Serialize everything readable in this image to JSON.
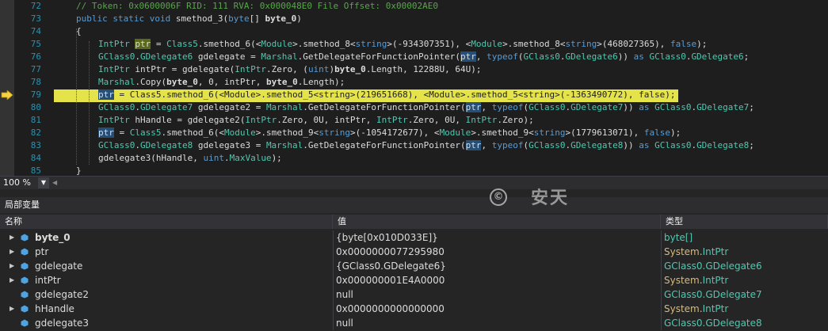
{
  "editor": {
    "line_numbers": [
      "72",
      "73",
      "74",
      "75",
      "76",
      "77",
      "78",
      "79",
      "80",
      "81",
      "82",
      "83",
      "84",
      "85"
    ],
    "current_line_marker": "arrow-right-icon",
    "lines": [
      {
        "tokens": [
          [
            "c",
            "// Token: 0x0600006F RID: 111 RVA: 0x000048E0 File Offset: 0x00002AE0"
          ]
        ]
      },
      {
        "tokens": [
          [
            "k",
            "public"
          ],
          [
            "",
            " "
          ],
          [
            "k",
            "static"
          ],
          [
            "",
            " "
          ],
          [
            "k",
            "void"
          ],
          [
            "",
            " smethod_3("
          ],
          [
            "k",
            "byte"
          ],
          [
            "",
            "[] "
          ],
          [
            "b",
            "byte_0"
          ],
          [
            "",
            ")"
          ]
        ]
      },
      {
        "tokens": [
          [
            "",
            "{"
          ]
        ]
      },
      {
        "tokens": [
          [
            "t",
            "IntPtr"
          ],
          [
            "",
            " "
          ],
          [
            "hl2",
            "ptr"
          ],
          [
            "",
            " = "
          ],
          [
            "t",
            "Class5"
          ],
          [
            "",
            ".smethod_6(<"
          ],
          [
            "t",
            "Module"
          ],
          [
            "",
            ">.smethod_8<"
          ],
          [
            "k",
            "string"
          ],
          [
            "",
            ">(-934307351), <"
          ],
          [
            "t",
            "Module"
          ],
          [
            "",
            ">.smethod_8<"
          ],
          [
            "k",
            "string"
          ],
          [
            "",
            ">(468027365), "
          ],
          [
            "k",
            "false"
          ],
          [
            "",
            ");"
          ]
        ]
      },
      {
        "tokens": [
          [
            "t",
            "GClass0"
          ],
          [
            "",
            "."
          ],
          [
            "t",
            "GDelegate6"
          ],
          [
            "",
            " gdelegate = "
          ],
          [
            "t",
            "Marshal"
          ],
          [
            "",
            ".GetDelegateForFunctionPointer("
          ],
          [
            "hl",
            "ptr"
          ],
          [
            "",
            ", "
          ],
          [
            "k",
            "typeof"
          ],
          [
            "",
            "("
          ],
          [
            "t",
            "GClass0"
          ],
          [
            "",
            "."
          ],
          [
            "t",
            "GDelegate6"
          ],
          [
            "",
            ")) "
          ],
          [
            "k",
            "as"
          ],
          [
            "",
            " "
          ],
          [
            "t",
            "GClass0"
          ],
          [
            "",
            "."
          ],
          [
            "t",
            "GDelegate6"
          ],
          [
            "",
            ";"
          ]
        ]
      },
      {
        "tokens": [
          [
            "t",
            "IntPtr"
          ],
          [
            "",
            " intPtr = gdelegate("
          ],
          [
            "t",
            "IntPtr"
          ],
          [
            "",
            ".Zero, ("
          ],
          [
            "k",
            "uint"
          ],
          [
            "",
            ")"
          ],
          [
            "b",
            "byte_0"
          ],
          [
            "",
            ".Length, 12288U, 64U);"
          ]
        ]
      },
      {
        "tokens": [
          [
            "t",
            "Marshal"
          ],
          [
            "",
            ".Copy("
          ],
          [
            "b",
            "byte_0"
          ],
          [
            "",
            ", 0, intPtr, "
          ],
          [
            "b",
            "byte_0"
          ],
          [
            "",
            ".Length);"
          ]
        ]
      },
      {
        "current": true,
        "tokens": [
          [
            "hl",
            "ptr"
          ],
          [
            "",
            " = Class5.smethod_6(<Module>.smethod_5<string>(219651668), <Module>.smethod_5<string>(-1363490772), false);"
          ]
        ]
      },
      {
        "tokens": [
          [
            "t",
            "GClass0"
          ],
          [
            "",
            "."
          ],
          [
            "t",
            "GDelegate7"
          ],
          [
            "",
            " gdelegate2 = "
          ],
          [
            "t",
            "Marshal"
          ],
          [
            "",
            ".GetDelegateForFunctionPointer("
          ],
          [
            "hl",
            "ptr"
          ],
          [
            "",
            ", "
          ],
          [
            "k",
            "typeof"
          ],
          [
            "",
            "("
          ],
          [
            "t",
            "GClass0"
          ],
          [
            "",
            "."
          ],
          [
            "t",
            "GDelegate7"
          ],
          [
            "",
            ")) "
          ],
          [
            "k",
            "as"
          ],
          [
            "",
            " "
          ],
          [
            "t",
            "GClass0"
          ],
          [
            "",
            "."
          ],
          [
            "t",
            "GDelegate7"
          ],
          [
            "",
            ";"
          ]
        ]
      },
      {
        "tokens": [
          [
            "t",
            "IntPtr"
          ],
          [
            "",
            " hHandle = gdelegate2("
          ],
          [
            "t",
            "IntPtr"
          ],
          [
            "",
            ".Zero, 0U, intPtr, "
          ],
          [
            "t",
            "IntPtr"
          ],
          [
            "",
            ".Zero, 0U, "
          ],
          [
            "t",
            "IntPtr"
          ],
          [
            "",
            ".Zero);"
          ]
        ]
      },
      {
        "tokens": [
          [
            "hl",
            "ptr"
          ],
          [
            "",
            " = "
          ],
          [
            "t",
            "Class5"
          ],
          [
            "",
            ".smethod_6(<"
          ],
          [
            "t",
            "Module"
          ],
          [
            "",
            ">.smethod_9<"
          ],
          [
            "k",
            "string"
          ],
          [
            "",
            ">(-1054172677), <"
          ],
          [
            "t",
            "Module"
          ],
          [
            "",
            ">.smethod_9<"
          ],
          [
            "k",
            "string"
          ],
          [
            "",
            ">(1779613071), "
          ],
          [
            "k",
            "false"
          ],
          [
            "",
            ");"
          ]
        ]
      },
      {
        "tokens": [
          [
            "t",
            "GClass0"
          ],
          [
            "",
            "."
          ],
          [
            "t",
            "GDelegate8"
          ],
          [
            "",
            " gdelegate3 = "
          ],
          [
            "t",
            "Marshal"
          ],
          [
            "",
            ".GetDelegateForFunctionPointer("
          ],
          [
            "hl",
            "ptr"
          ],
          [
            "",
            ", "
          ],
          [
            "k",
            "typeof"
          ],
          [
            "",
            "("
          ],
          [
            "t",
            "GClass0"
          ],
          [
            "",
            "."
          ],
          [
            "t",
            "GDelegate8"
          ],
          [
            "",
            ")) "
          ],
          [
            "k",
            "as"
          ],
          [
            "",
            " "
          ],
          [
            "t",
            "GClass0"
          ],
          [
            "",
            "."
          ],
          [
            "t",
            "GDelegate8"
          ],
          [
            "",
            ";"
          ]
        ]
      },
      {
        "tokens": [
          [
            "",
            "gdelegate3(hHandle, "
          ],
          [
            "k",
            "uint"
          ],
          [
            "",
            "."
          ],
          [
            "t",
            "MaxValue"
          ],
          [
            "",
            ");"
          ]
        ]
      },
      {
        "tokens": [
          [
            "",
            "}"
          ]
        ]
      }
    ]
  },
  "zoom": {
    "value": "100 %",
    "dropdown_icon": "chevron-down-icon"
  },
  "locals": {
    "title": "局部变量",
    "columns": {
      "name": "名称",
      "value": "值",
      "type": "类型"
    },
    "rows": [
      {
        "name": "byte_0",
        "bold": true,
        "expandable": true,
        "value": "{byte[0x010D033E]}",
        "value_style": "vred",
        "type_prefix": "byte[]",
        "type_suffix": "",
        "type_style": "blue"
      },
      {
        "name": "ptr",
        "bold": false,
        "expandable": true,
        "value": "0x0000000077295980",
        "value_style": "",
        "type_prefix": "System.",
        "type_suffix": "IntPtr",
        "type_style": "sys"
      },
      {
        "name": "gdelegate",
        "bold": false,
        "expandable": true,
        "value": "{GClass0.GDelegate6}",
        "value_style": "vred",
        "type_prefix": "GClass0.GDelegate6",
        "type_suffix": "",
        "type_style": "blue"
      },
      {
        "name": "intPtr",
        "bold": false,
        "expandable": true,
        "value": "0x000000001E4A0000",
        "value_style": "",
        "type_prefix": "System.",
        "type_suffix": "IntPtr",
        "type_style": "sys"
      },
      {
        "name": "gdelegate2",
        "bold": false,
        "expandable": false,
        "value": "null",
        "value_style": "vblue",
        "type_prefix": "GClass0.GDelegate7",
        "type_suffix": "",
        "type_style": "blue"
      },
      {
        "name": "hHandle",
        "bold": false,
        "expandable": true,
        "value": "0x0000000000000000",
        "value_style": "",
        "type_prefix": "System.",
        "type_suffix": "IntPtr",
        "type_style": "sys"
      },
      {
        "name": "gdelegate3",
        "bold": false,
        "expandable": false,
        "value": "null",
        "value_style": "vblue",
        "type_prefix": "GClass0.GDelegate8",
        "type_suffix": "",
        "type_style": "blue"
      }
    ]
  },
  "watermark": {
    "symbol": "©",
    "text": "安天"
  },
  "colors": {
    "editor_bg": "#1e1e1e",
    "keyword": "#569cd6",
    "type": "#4ec9b0",
    "comment": "#57a64a",
    "line_number": "#2b91af",
    "current_line": "#e5e34a",
    "system_type": "#d7ba7d",
    "value_red": "#d16969"
  }
}
